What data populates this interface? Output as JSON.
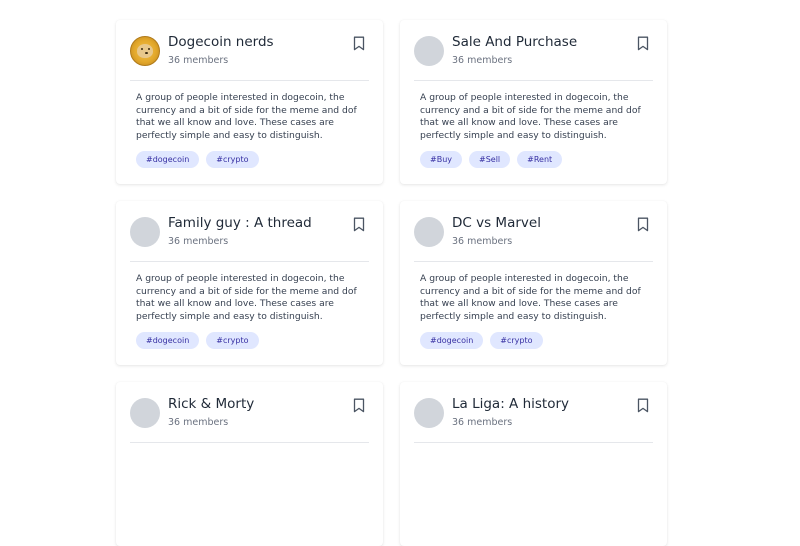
{
  "groups": [
    {
      "title": "Dogecoin nerds",
      "members": "36 members",
      "avatar": "doge-coin-logo",
      "description": "A group of people interested in dogecoin, the currency and a bit of side for the meme and dof that we all know and love. These cases are perfectly simple and easy to distinguish.",
      "tags": [
        "#dogecoin",
        "#crypto"
      ]
    },
    {
      "title": "Sale And Purchase",
      "members": "36 members",
      "avatar": "placeholder",
      "description": "A group of people interested in dogecoin, the currency and a bit of side for the meme and dof that we all know and love. These cases are perfectly simple and easy to distinguish.",
      "tags": [
        "#Buy",
        "#Sell",
        "#Rent"
      ]
    },
    {
      "title": "Family guy : A thread",
      "members": "36 members",
      "avatar": "placeholder",
      "description": "A group of people interested in dogecoin, the currency and a bit of side for the meme and dof that we all know and love. These cases are perfectly simple and easy to distinguish.",
      "tags": [
        "#dogecoin",
        "#crypto"
      ]
    },
    {
      "title": "DC vs Marvel",
      "members": "36 members",
      "avatar": "placeholder",
      "description": "A group of people interested in dogecoin, the currency and a bit of side for the meme and dof that we all know and love. These cases are perfectly simple and easy to distinguish.",
      "tags": [
        "#dogecoin",
        "#crypto"
      ]
    },
    {
      "title": "Rick & Morty",
      "members": "36 members",
      "avatar": "placeholder",
      "description": "",
      "tags": []
    },
    {
      "title": "La Liga: A history",
      "members": "36 members",
      "avatar": "placeholder",
      "description": "",
      "tags": []
    }
  ],
  "colors": {
    "tag_bg": "#e0e7ff",
    "tag_text": "#3730a3",
    "avatar_placeholder": "#d1d5db",
    "title_text": "#1f2937",
    "muted_text": "#6b7280"
  },
  "icons": {
    "bookmark": "bookmark-icon"
  }
}
